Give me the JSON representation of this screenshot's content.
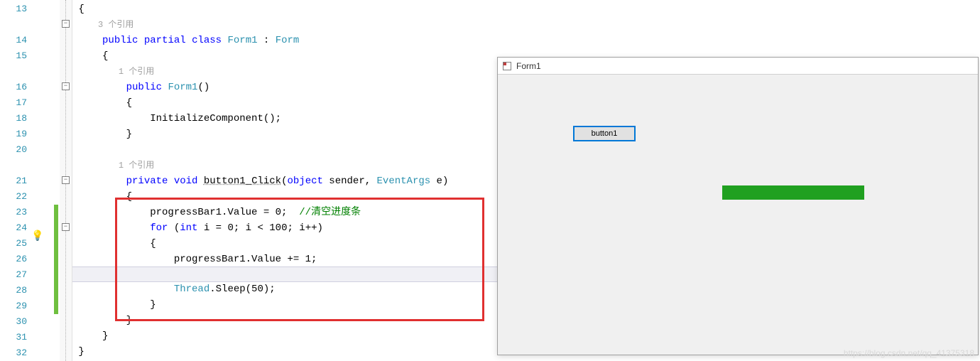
{
  "editor": {
    "line_numbers": [
      "13",
      "14",
      "15",
      "16",
      "17",
      "18",
      "19",
      "20",
      "21",
      "22",
      "23",
      "24",
      "25",
      "26",
      "27",
      "28",
      "29",
      "30",
      "31",
      "32"
    ],
    "ref_hint1": "3 个引用",
    "ref_hint2": "1 个引用",
    "ref_hint3": "1 个引用",
    "fold_minus": "−",
    "lightbulb": "💡",
    "tokens": {
      "brace_open": "{",
      "brace_close": "}",
      "kw_public": "public",
      "kw_partial": "partial",
      "kw_class": "class",
      "type_form1": "Form1",
      "colon": " : ",
      "type_form": "Form",
      "ctor_name": "Form1",
      "parens": "()",
      "init_call": "InitializeComponent();",
      "kw_private": "private",
      "kw_void": "void",
      "method_name": "button1_Click",
      "open_paren": "(",
      "kw_object": "object",
      "param_sender": " sender, ",
      "type_eventargs": "EventArgs",
      "param_e": " e)",
      "l23a": "progressBar1.Value = 0;  ",
      "l23b": "//清空进度条",
      "kw_for": "for",
      "l24a": " (",
      "kw_int": "int",
      "l24b": " i = 0; i < 100; i++)",
      "l26": "progressBar1.Value += 1;",
      "type_thread": "Thread",
      "l28a": ".Sleep(50);"
    }
  },
  "form": {
    "title": "Form1",
    "button_label": "button1"
  },
  "watermark": "https://blog.csdn.net/qq_41375318"
}
